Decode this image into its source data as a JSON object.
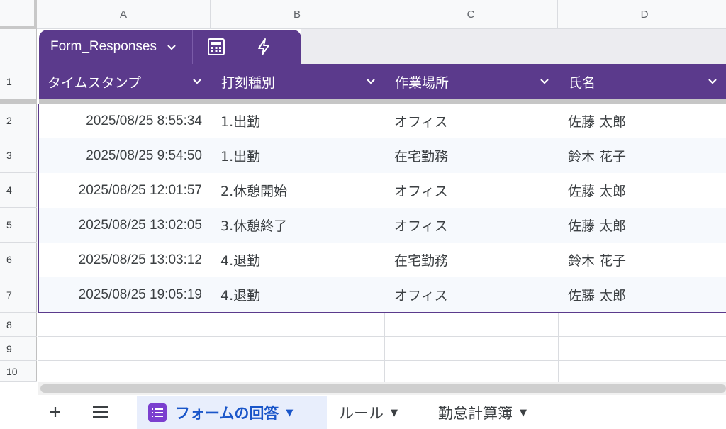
{
  "columns": [
    "A",
    "B",
    "C",
    "D"
  ],
  "rows": [
    "1",
    "2",
    "3",
    "4",
    "5",
    "6",
    "7",
    "8",
    "9",
    "10"
  ],
  "table": {
    "name": "Form_Responses",
    "headers": [
      "タイムスタンプ",
      "打刻種別",
      "作業場所",
      "氏名"
    ],
    "data": [
      [
        "2025/08/25 8:55:34",
        "1.出勤",
        "オフィス",
        "佐藤 太郎"
      ],
      [
        "2025/08/25 9:54:50",
        "1.出勤",
        "在宅勤務",
        "鈴木 花子"
      ],
      [
        "2025/08/25 12:01:57",
        "2.休憩開始",
        "オフィス",
        "佐藤 太郎"
      ],
      [
        "2025/08/25 13:02:05",
        "3.休憩終了",
        "オフィス",
        "佐藤 太郎"
      ],
      [
        "2025/08/25 13:03:12",
        "4.退勤",
        "在宅勤務",
        "鈴木 花子"
      ],
      [
        "2025/08/25 19:05:19",
        "4.退勤",
        "オフィス",
        "佐藤 太郎"
      ]
    ]
  },
  "sheets": [
    {
      "label": "フォームの回答",
      "active": true,
      "icon": "form-icon"
    },
    {
      "label": "ルール",
      "active": false
    },
    {
      "label": "勤怠計算簿",
      "active": false
    }
  ],
  "colors": {
    "table_accent": "#5b3a8c",
    "active_tab_text": "#1a56c9",
    "form_icon": "#7b3fcf"
  }
}
